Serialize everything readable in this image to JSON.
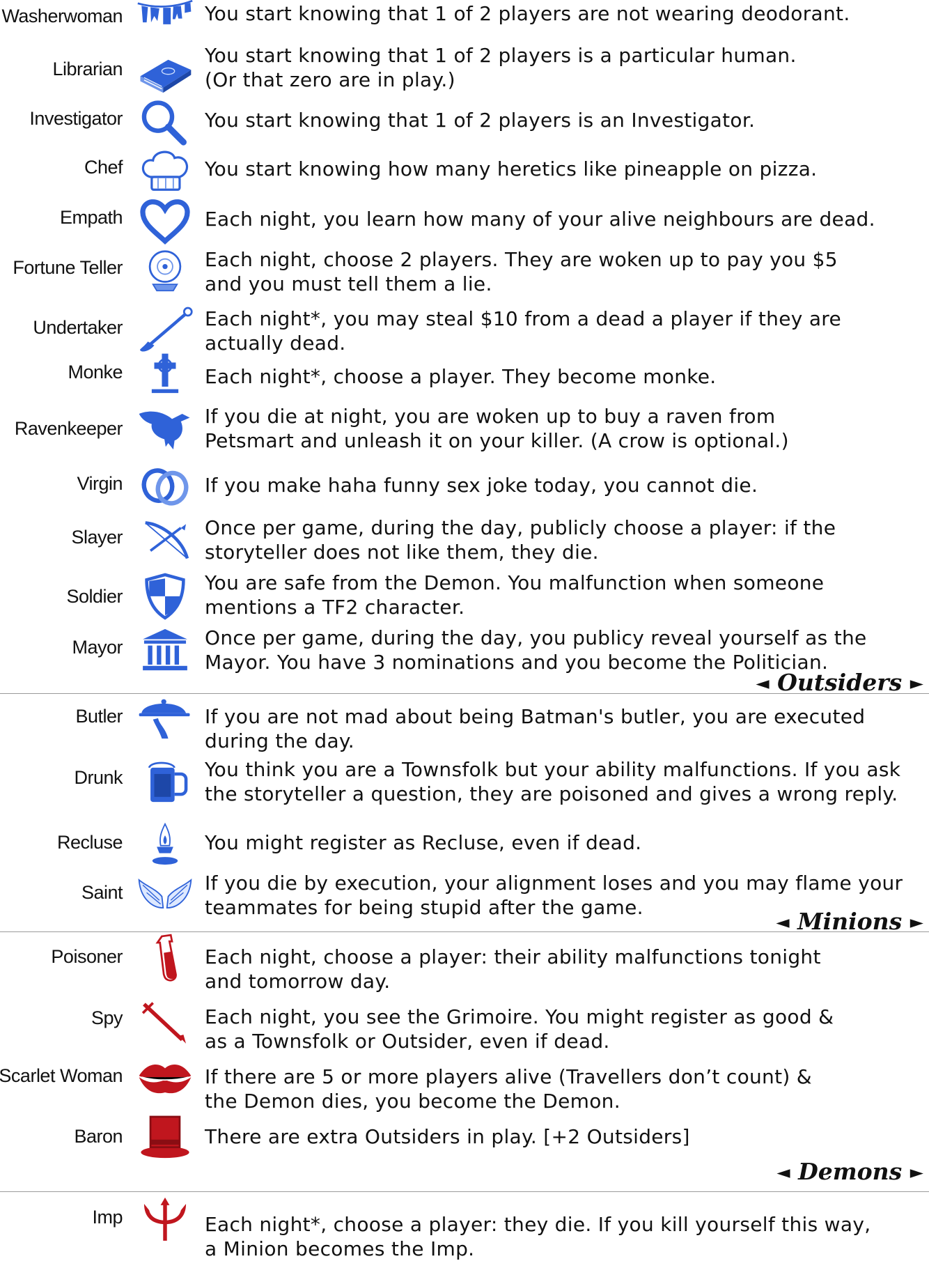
{
  "colors": {
    "townsfolk": "#2f62d8",
    "minion": "#c0161e",
    "demon": "#b8161c"
  },
  "townsfolk": [
    {
      "name": "Washerwoman",
      "icon": "clothesline-icon",
      "desc": [
        "You start knowing that 1 of 2 players are not wearing deodorant."
      ]
    },
    {
      "name": "Librarian",
      "icon": "book-icon",
      "desc": [
        "You start knowing that 1 of 2 players is a particular human.",
        "(Or that zero are in play.)"
      ]
    },
    {
      "name": "Investigator",
      "icon": "magnifying-glass-icon",
      "desc": [
        "You start knowing that 1 of 2 players is an Investigator."
      ]
    },
    {
      "name": "Chef",
      "icon": "chef-hat-icon",
      "desc": [
        "You start knowing how many heretics like pineapple on pizza."
      ]
    },
    {
      "name": "Empath",
      "icon": "heart-icon",
      "desc": [
        "Each night, you learn how many of your alive neighbours are dead."
      ]
    },
    {
      "name": "Fortune Teller",
      "icon": "crystal-ball-icon",
      "desc": [
        "Each night, choose 2 players. They are woken up to pay you $5",
        "and you must tell them a lie."
      ]
    },
    {
      "name": "Undertaker",
      "icon": "shovel-icon",
      "desc": [
        "Each night*, you may steal $10 from a dead a player if they are",
        "actually dead."
      ]
    },
    {
      "name": "Monke",
      "icon": "grave-cross-icon",
      "desc": [
        "Each night*, choose a player. They become monke."
      ]
    },
    {
      "name": "Ravenkeeper",
      "icon": "raven-icon",
      "desc": [
        "If you die at night, you are woken up to buy a raven from",
        "Petsmart and unleash it on your killer. (A crow is optional.)"
      ]
    },
    {
      "name": "Virgin",
      "icon": "rings-icon",
      "desc": [
        "If you make haha funny sex joke today, you cannot die."
      ]
    },
    {
      "name": "Slayer",
      "icon": "crossbow-icon",
      "desc": [
        "Once per game, during the day, publicly choose a player: if the",
        "storyteller does not like them, they die."
      ]
    },
    {
      "name": "Soldier",
      "icon": "shield-icon",
      "desc": [
        "You are safe from the Demon. You malfunction when someone",
        "mentions a TF2 character."
      ]
    },
    {
      "name": "Mayor",
      "icon": "columns-building-icon",
      "desc": [
        "Once per game, during the day, you publicy reveal yourself as the",
        "Mayor. You have 3 nominations and you become the Politician."
      ]
    }
  ],
  "outsiders_label": "Outsiders",
  "outsiders": [
    {
      "name": "Butler",
      "icon": "serving-cloche-icon",
      "desc": [
        "If you are not mad about being Batman's butler, you are executed",
        "during the day."
      ]
    },
    {
      "name": "Drunk",
      "icon": "beer-mug-icon",
      "desc": [
        "You think you are a Townsfolk but your ability malfunctions. If you ask",
        "the storyteller a question, they are poisoned and gives a wrong reply."
      ]
    },
    {
      "name": "Recluse",
      "icon": "oil-lamp-icon",
      "desc": [
        "You might register as Recluse, even if dead."
      ]
    },
    {
      "name": "Saint",
      "icon": "wings-icon",
      "desc": [
        "If you die by execution, your alignment loses and you may flame your",
        "teammates for being stupid after the game."
      ]
    }
  ],
  "minions_label": "Minions",
  "minions": [
    {
      "name": "Poisoner",
      "icon": "poison-vial-icon",
      "desc": [
        "Each night, choose a player: their ability malfunctions tonight",
        "and tomorrow day."
      ]
    },
    {
      "name": "Spy",
      "icon": "dagger-icon",
      "desc": [
        "Each night, you see the Grimoire. You might register as good &",
        "as a Townsfolk or Outsider, even if dead."
      ]
    },
    {
      "name": "Scarlet Woman",
      "icon": "lips-kiss-icon",
      "desc": [
        "If there are 5 or more players alive (Travellers don’t count) &",
        "the Demon dies, you become the Demon."
      ]
    },
    {
      "name": "Baron",
      "icon": "top-hat-icon",
      "desc": [
        "There are extra Outsiders in play. [+2 Outsiders]"
      ]
    }
  ],
  "demons_label": "Demons",
  "demons": [
    {
      "name": "Imp",
      "icon": "trident-icon",
      "desc": [
        "Each night*, choose a player: they die. If you kill yourself this way,",
        "a Minion becomes the Imp."
      ]
    }
  ]
}
